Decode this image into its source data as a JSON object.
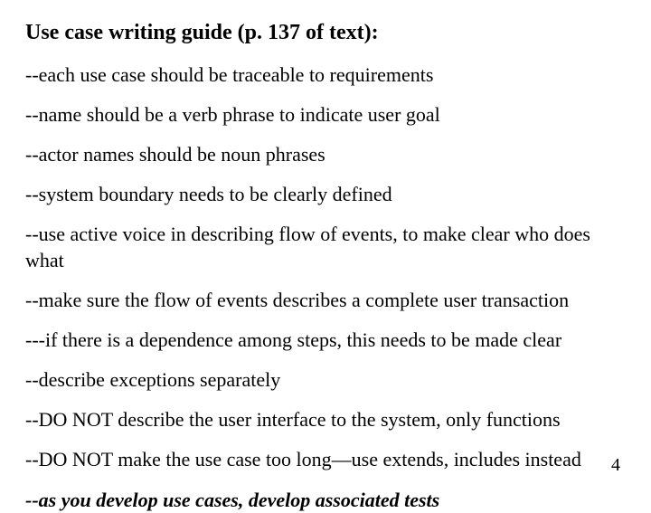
{
  "title": "Use case writing guide (p. 137 of text):",
  "items": [
    "--each use case should be traceable to requirements",
    "--name should be a verb phrase to indicate user goal",
    "--actor names should be noun phrases",
    "--system boundary needs to be clearly defined",
    "--use active voice in describing flow of events, to make clear who does what",
    "--make sure the flow of events describes a complete user transaction",
    "---if there is a dependence among steps, this needs to be made clear",
    "--describe exceptions separately",
    "--DO NOT describe the user interface to the system, only functions",
    "--DO NOT make the use case too long—use extends, includes instead",
    "--as you develop use cases, develop associated tests"
  ],
  "page_number": "4"
}
